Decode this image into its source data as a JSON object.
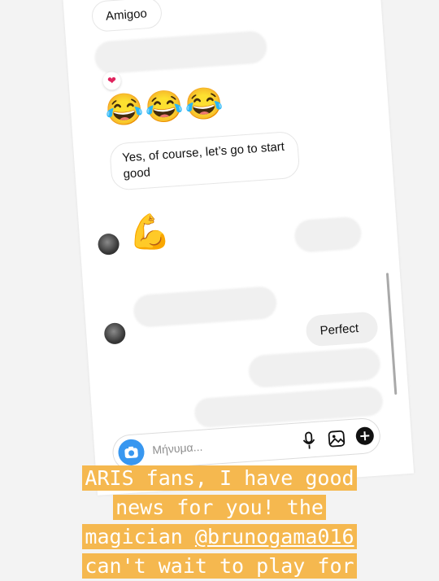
{
  "chat": {
    "messages": {
      "amigoo": "Amigoo",
      "reply_long": "Yes, of course, let’s go to start good",
      "perfect": "Perfect"
    },
    "reactions": {
      "heart": "❤"
    },
    "emojis": {
      "laugh_row": "😂😂😂",
      "flex": "💪"
    },
    "composer": {
      "placeholder": "Μήνυμα..."
    },
    "icons": {
      "camera": "camera-icon",
      "mic": "microphone-icon",
      "gallery": "gallery-icon",
      "plus": "plus-icon"
    },
    "colors": {
      "accent": "#3897f0",
      "highlight": "#f5b84f"
    }
  },
  "story_caption": {
    "line1": "ARIS fans, I have good",
    "line2": "news for you! the",
    "line3_prefix": "magician ",
    "line3_handle": "@brunogama016",
    "line4": "can't wait to play for"
  }
}
